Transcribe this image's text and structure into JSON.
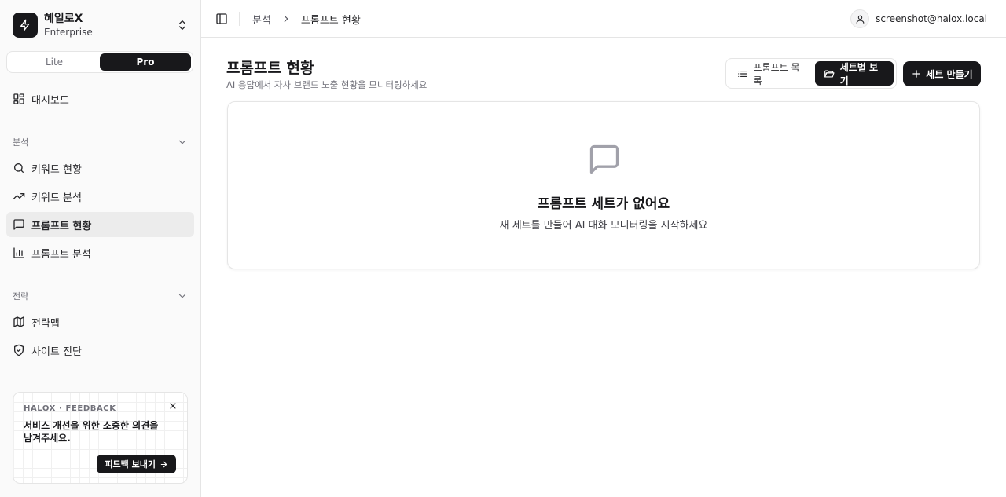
{
  "brand": {
    "name": "헤일로X",
    "plan": "Enterprise"
  },
  "plan_toggle": {
    "options": [
      "Lite",
      "Pro"
    ],
    "selected": "Pro"
  },
  "sidebar": {
    "dashboard": {
      "label": "대시보드",
      "icon": "dashboard-icon"
    },
    "groups": [
      {
        "label": "분석",
        "items": [
          {
            "label": "키워드 현황",
            "icon": "search-icon"
          },
          {
            "label": "키워드 분석",
            "icon": "trending-up-icon"
          },
          {
            "label": "프롬프트 현황",
            "icon": "message-square-icon",
            "active": true
          },
          {
            "label": "프롬프트 분석",
            "icon": "bar-chart-icon"
          }
        ]
      },
      {
        "label": "전략",
        "items": [
          {
            "label": "전략맵",
            "icon": "map-icon"
          },
          {
            "label": "사이트 진단",
            "icon": "shield-check-icon"
          }
        ]
      }
    ]
  },
  "feedback": {
    "tag": "HALOX · FEEDBACK",
    "message": "서비스 개선을 위한 소중한 의견을 남겨주세요.",
    "button": "피드백 보내기"
  },
  "header": {
    "breadcrumb": [
      "분석",
      "프롬프트 현황"
    ],
    "user_email": "screenshot@halox.local"
  },
  "main": {
    "title": "프롬프트 현황",
    "subtitle": "AI 응답에서 자사 브랜드 노출 현황을 모니터링하세요",
    "view_toggle": {
      "list_label": "프롬프트 목록",
      "set_label": "세트별 보기",
      "selected": "세트별 보기"
    },
    "create_button": "세트 만들기",
    "empty": {
      "title": "프롬프트 세트가 없어요",
      "description": "새 세트를 만들어 AI 대화 모니터링을 시작하세요"
    }
  },
  "colors": {
    "primary": "#18181b",
    "border": "#e5e5e5",
    "sidebar_bg": "#fafafa",
    "active_bg": "#ececec",
    "muted_text": "#71717a"
  }
}
